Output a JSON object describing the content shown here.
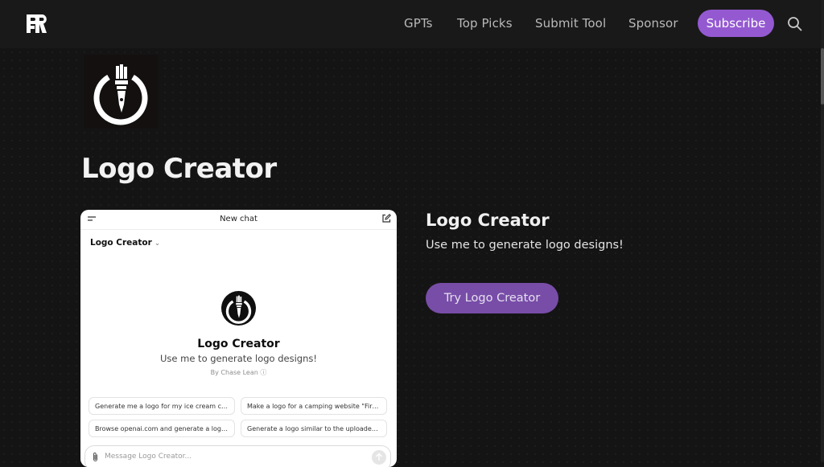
{
  "header": {
    "brand_icon": "rr-monogram-logo",
    "nav": [
      {
        "label": "GPTs"
      },
      {
        "label": "Top Picks"
      },
      {
        "label": "Submit Tool"
      },
      {
        "label": "Sponsor"
      }
    ],
    "subscribe_label": "Subscribe",
    "search_icon": "search-icon"
  },
  "tool": {
    "logo_icon": "paintbrush-in-circle-logo",
    "title": "Logo Creator"
  },
  "preview": {
    "chat_title": "New chat",
    "gpt_selector": "Logo Creator",
    "gpt_name": "Logo Creator",
    "gpt_description": "Use me to generate logo designs!",
    "gpt_author": "By Chase Lean",
    "suggestions": [
      "Generate me a logo for my ice cream company",
      "Make a logo for a camping website \"Firecamp\"",
      "Browse openai.com and generate a logo for it",
      "Generate a logo similar to the uploaded image"
    ],
    "message_placeholder": "Message Logo Creator..."
  },
  "info": {
    "title": "Logo Creator",
    "description": "Use me to generate logo designs!",
    "try_button": "Try Logo Creator"
  },
  "colors": {
    "background": "#151415",
    "accent": "#9459d1",
    "try_button": "#784da8"
  }
}
